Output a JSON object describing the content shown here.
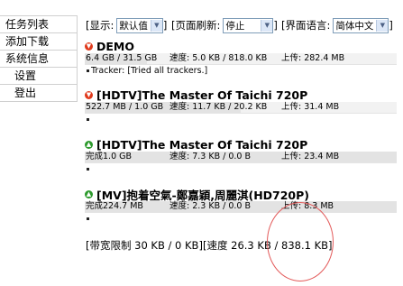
{
  "sidebar": {
    "items": [
      {
        "label": "任务列表",
        "name": "sidebar-item-task-list",
        "level": 1
      },
      {
        "label": "添加下载",
        "name": "sidebar-item-add-download",
        "level": 1
      },
      {
        "label": "系统信息",
        "name": "sidebar-item-system-info",
        "level": 1
      },
      {
        "label": "设置",
        "name": "sidebar-item-settings",
        "level": 2
      },
      {
        "label": "登出",
        "name": "sidebar-item-logout",
        "level": 2
      }
    ]
  },
  "toolbar": {
    "display_label": "[显示:",
    "display_value": "默认值",
    "display_close": "]",
    "refresh_label": "[页面刷新:",
    "refresh_value": "停止",
    "refresh_close": "]",
    "language_label": "[界面语言:",
    "language_value": "简体中文",
    "language_close": "]"
  },
  "torrents": [
    {
      "status": "paused",
      "status_color": "#e03a1c",
      "status_icon": "arrow-down-icon",
      "name": "DEMO",
      "size": "6.4 GB / 31.5 GB",
      "speed": "速度: 5.0 KB / 818.0 KB",
      "upload": "上传: 282.4 MB",
      "progress": 0.2,
      "tracker": "Tracker: [Tried all trackers.]"
    },
    {
      "status": "paused",
      "status_color": "#e03a1c",
      "status_icon": "arrow-down-icon",
      "name": "[HDTV]The Master Of Taichi 720P",
      "size": "522.7 MB / 1.0 GB",
      "speed": "速度: 11.7 KB / 20.2 KB",
      "upload": "上传: 31.4 MB",
      "progress": 0.5,
      "tracker": ""
    },
    {
      "status": "completed",
      "status_color": "#2d9a2d",
      "status_icon": "arrow-up-icon",
      "name": "[HDTV]The Master Of Taichi 720P",
      "size": "完成1.0 GB",
      "speed": "速度: 7.3 KB / 0.0 B",
      "upload": "上传: 23.4 MB",
      "progress": 1.0,
      "tracker": ""
    },
    {
      "status": "completed",
      "status_color": "#2d9a2d",
      "status_icon": "arrow-up-icon",
      "name": "[MV]抱着空氣-鄭嘉穎,周麗淇(HD720P)",
      "size": "完成224.7 MB",
      "speed": "速度: 2.3 KB / 0.0 B",
      "upload": "上传: 8.3 MB",
      "progress": 1.0,
      "tracker": ""
    }
  ],
  "footer": {
    "bandwidth": "[带宽限制 30 KB / 0 KB]",
    "speed": "[速度 26.3 KB / 838.1 KB]"
  },
  "colors": {
    "annotation_circle": "#e35a5a",
    "select_border": "#7f9db9"
  }
}
